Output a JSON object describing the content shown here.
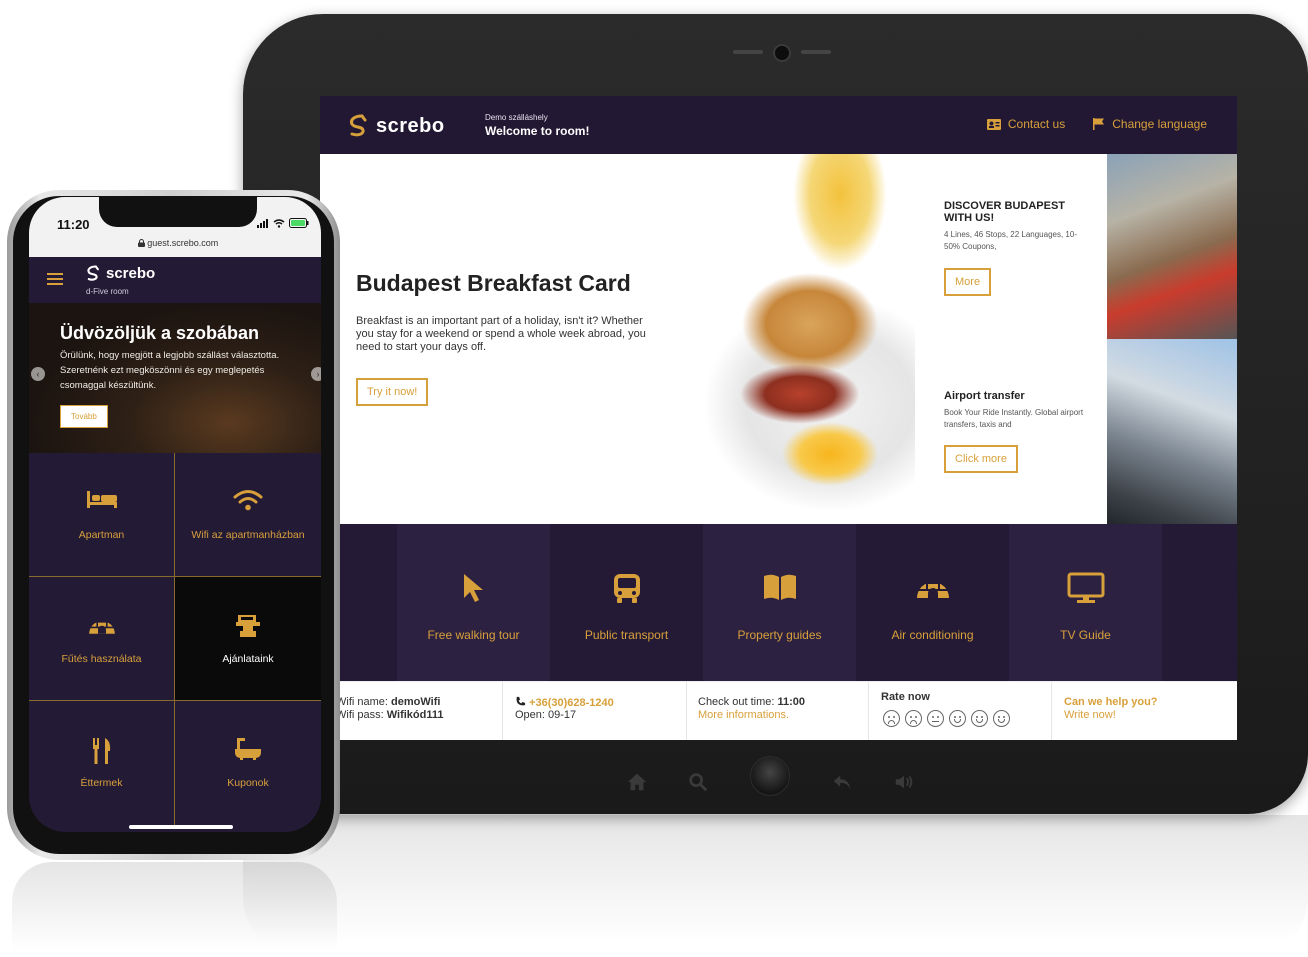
{
  "tablet": {
    "brand": "screbo",
    "hotel_name": "Demo szálláshely",
    "welcome": "Welcome to room!",
    "nav": {
      "contact": "Contact us",
      "language": "Change language"
    },
    "hero": {
      "title": "Budapest Breakfast Card",
      "description": "Breakfast is an important part of a holiday, isn't it? Whether you stay for a weekend or spend a whole week abroad, you need to start your days off.",
      "button": "Try it now!"
    },
    "promos": [
      {
        "title": "DISCOVER BUDAPEST WITH US!",
        "description": "4 Lines, 46 Stops, 22 Languages, 10-50% Coupons,",
        "button": "More"
      },
      {
        "title": "Airport transfer",
        "description": "Book Your Ride Instantly. Global airport transfers, taxis and",
        "button": "Click more"
      }
    ],
    "tiles": [
      {
        "label": "Free walking tour",
        "icon": "cursor-icon"
      },
      {
        "label": "Public transport",
        "icon": "bus-icon"
      },
      {
        "label": "Property guides",
        "icon": "book-icon"
      },
      {
        "label": "Air conditioning",
        "icon": "igloo-icon"
      },
      {
        "label": "TV Guide",
        "icon": "monitor-icon"
      }
    ],
    "footer": {
      "wifi_name_label": "Wifi name:",
      "wifi_name": "demoWifi",
      "wifi_pass_label": "Wifi pass:",
      "wifi_pass": "Wifikód111",
      "phone": "+36(30)628-1240",
      "open": "Open: 09-17",
      "checkout_label": "Check out time:",
      "checkout_time": "11:00",
      "more_info": "More informations.",
      "rate_label": "Rate now",
      "help_title": "Can we help you?",
      "help_link": "Write now!"
    }
  },
  "phone": {
    "time": "11:20",
    "url": "guest.screbo.com",
    "brand": "screbo",
    "room": "d-Five room",
    "hero": {
      "title": "Üdvözöljük a szobában",
      "description": "Örülünk, hogy megjött a legjobb szállást választotta. Szeretnénk ezt megköszönni és egy meglepetés csomaggal készültünk.",
      "button": "Tovább"
    },
    "tiles": [
      {
        "label": "Apartman",
        "icon": "bed-icon"
      },
      {
        "label": "Wifi az apartmanházban",
        "icon": "wifi-icon"
      },
      {
        "label": "Fűtés használata",
        "icon": "igloo-icon"
      },
      {
        "label": "Ajánlataink",
        "icon": "offers-icon"
      },
      {
        "label": "Éttermek",
        "icon": "cutlery-icon"
      },
      {
        "label": "Kuponok",
        "icon": "bath-icon"
      }
    ]
  },
  "colors": {
    "brand_dark": "#231a36",
    "accent_gold": "#d8a03b"
  }
}
